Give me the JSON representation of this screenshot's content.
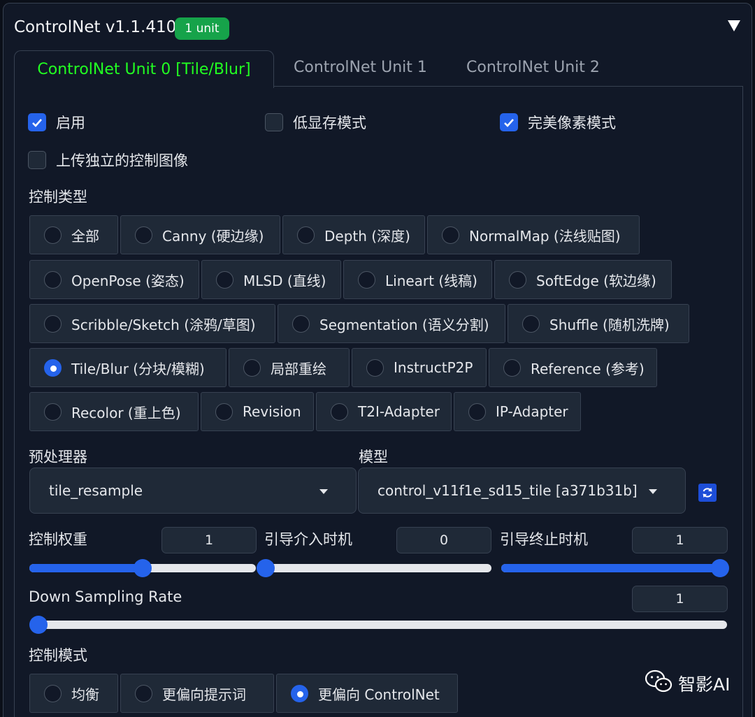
{
  "header": {
    "title": "ControlNet v1.1.410",
    "badge": "1 unit"
  },
  "tabs": [
    {
      "label": "ControlNet Unit 0 [Tile/Blur]"
    },
    {
      "label": "ControlNet Unit 1"
    },
    {
      "label": "ControlNet Unit 2"
    }
  ],
  "checkboxes": {
    "enable": {
      "label": "启用",
      "checked": true
    },
    "low_vram": {
      "label": "低显存模式",
      "checked": false
    },
    "pixel_perfect": {
      "label": "完美像素模式",
      "checked": true
    },
    "upload_independent": {
      "label": "上传独立的控制图像",
      "checked": false
    }
  },
  "control_type": {
    "label": "控制类型",
    "selected": "Tile/Blur (分块/模糊)",
    "options": [
      "全部",
      "Canny (硬边缘)",
      "Depth (深度)",
      "NormalMap (法线贴图)",
      "OpenPose (姿态)",
      "MLSD (直线)",
      "Lineart (线稿)",
      "SoftEdge (软边缘)",
      "Scribble/Sketch (涂鸦/草图)",
      "Segmentation (语义分割)",
      "Shuffle (随机洗牌)",
      "Tile/Blur (分块/模糊)",
      "局部重绘",
      "InstructP2P",
      "Reference (参考)",
      "Recolor (重上色)",
      "Revision",
      "T2I-Adapter",
      "IP-Adapter"
    ]
  },
  "preprocessor": {
    "label": "预处理器",
    "value": "tile_resample"
  },
  "model": {
    "label": "模型",
    "value": "control_v11f1e_sd15_tile [a371b31b]"
  },
  "sliders": {
    "weight": {
      "label": "控制权重",
      "value": "1",
      "fraction": 0.5
    },
    "start": {
      "label": "引导介入时机",
      "value": "0",
      "fraction": 0.0
    },
    "end": {
      "label": "引导终止时机",
      "value": "1",
      "fraction": 1.0
    },
    "down_sampling": {
      "label": "Down Sampling Rate",
      "value": "1",
      "fraction": 0.0
    }
  },
  "control_mode": {
    "label": "控制模式",
    "options": [
      "均衡",
      "更偏向提示词",
      "更偏向 ControlNet"
    ],
    "selected": "更偏向 ControlNet"
  },
  "watermark": {
    "text": "智影AI"
  },
  "colors": {
    "accent": "#2563eb",
    "active_tab": "#22ff22",
    "badge": "#16a34a"
  }
}
